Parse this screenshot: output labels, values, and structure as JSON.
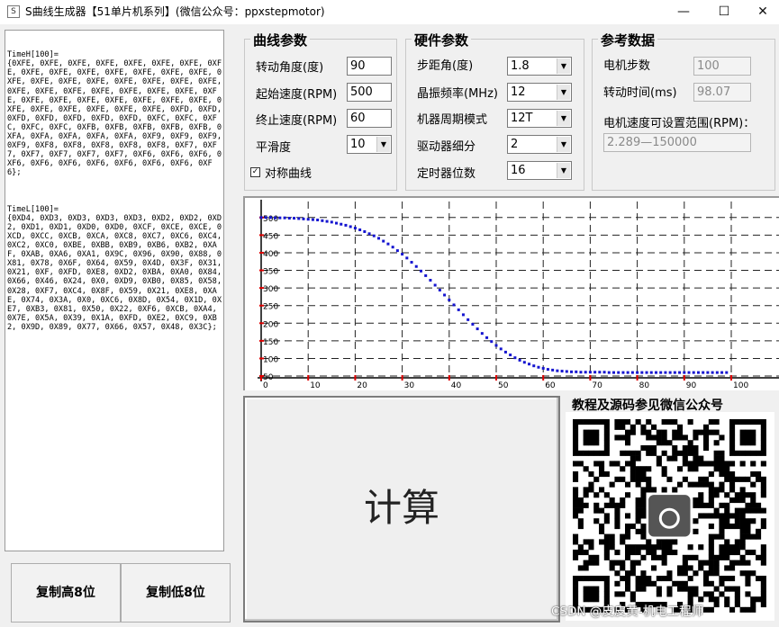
{
  "window": {
    "title": "S曲线生成器【51单片机系列】(微信公众号：ppхstepmotor)",
    "minimize": "—",
    "maximize": "☐",
    "close": "✕",
    "icon_label": "S"
  },
  "output": {
    "high_block": "TimeH[100]=\n{0XFE, 0XFE, 0XFE, 0XFE, 0XFE, 0XFE, 0XFE, 0XFE, 0XFE, 0XFE, 0XFE, 0XFE, 0XFE, 0XFE, 0XFE, 0XFE, 0XFE, 0XFE, 0XFE, 0XFE, 0XFE, 0XFE, 0XFE, 0XFE, 0XFE, 0XFE, 0XFE, 0XFE, 0XFE, 0XFE, 0XFE, 0XFE, 0XFE, 0XFE, 0XFE, 0XFE, 0XFE, 0XFE, 0XFE, 0XFE, 0XFE, 0XFE, 0XFE, 0XFE, 0XFD, 0XFD, 0XFD, 0XFD, 0XFD, 0XFD, 0XFD, 0XFC, 0XFC, 0XFC, 0XFC, 0XFC, 0XFB, 0XFB, 0XFB, 0XFB, 0XFB, 0XFA, 0XFA, 0XFA, 0XFA, 0XFA, 0XF9, 0XF9, 0XF9, 0XF9, 0XF8, 0XF8, 0XF8, 0XF8, 0XF8, 0XF7, 0XF7, 0XF7, 0XF7, 0XF7, 0XF7, 0XF6, 0XF6, 0XF6, 0XF6, 0XF6, 0XF6, 0XF6, 0XF6, 0XF6, 0XF6, 0XF6};",
    "low_block": "TimeL[100]=\n{0XD4, 0XD3, 0XD3, 0XD3, 0XD3, 0XD2, 0XD2, 0XD2, 0XD1, 0XD1, 0XD0, 0XD0, 0XCF, 0XCE, 0XCE, 0XCD, 0XCC, 0XCB, 0XCA, 0XC8, 0XC7, 0XC6, 0XC4, 0XC2, 0XC0, 0XBE, 0XBB, 0XB9, 0XB6, 0XB2, 0XAF, 0XAB, 0XA6, 0XA1, 0X9C, 0X96, 0X90, 0X88, 0X81, 0X78, 0X6F, 0X64, 0X59, 0X4D, 0X3F, 0X31, 0X21, 0XF, 0XFD, 0XE8, 0XD2, 0XBA, 0XA0, 0X84, 0X66, 0X46, 0X24, 0X0, 0XD9, 0XB0, 0X85, 0X58, 0X28, 0XF7, 0XC4, 0X8F, 0X59, 0X21, 0XE8, 0XAE, 0X74, 0X3A, 0X0, 0XC6, 0X8D, 0X54, 0X1D, 0XE7, 0XB3, 0X81, 0X50, 0X22, 0XF6, 0XCB, 0XA4, 0X7E, 0X5A, 0X39, 0X1A, 0XFD, 0XE2, 0XC9, 0XB2, 0X9D, 0X89, 0X77, 0X66, 0X57, 0X48, 0X3C};"
  },
  "buttons": {
    "copy_high": "复制高8位",
    "copy_low": "复制低8位",
    "calculate": "计算"
  },
  "curve_params": {
    "title": "曲线参数",
    "angle_label": "转动角度(度)",
    "angle_value": "90",
    "start_speed_label": "起始速度(RPM)",
    "start_speed_value": "500",
    "end_speed_label": "终止速度(RPM)",
    "end_speed_value": "60",
    "smooth_label": "平滑度",
    "smooth_value": "10",
    "symmetric_label": "对称曲线",
    "symmetric_checked": "✓"
  },
  "hardware_params": {
    "title": "硬件参数",
    "step_angle_label": "步距角(度)",
    "step_angle_value": "1.8",
    "crystal_label": "晶振频率(MHz)",
    "crystal_value": "12",
    "cycle_mode_label": "机器周期模式",
    "cycle_mode_value": "12T",
    "microstep_label": "驱动器细分",
    "microstep_value": "2",
    "timer_bits_label": "定时器位数",
    "timer_bits_value": "16"
  },
  "reference": {
    "title": "参考数据",
    "steps_label": "电机步数",
    "steps_value": "100",
    "time_label": "转动时间(ms)",
    "time_value": "98.07",
    "range_label": "电机速度可设置范围(RPM)：",
    "range_value": "2.289—150000"
  },
  "qr": {
    "caption": "教程及源码参见微信公众号"
  },
  "watermark": "CSDN @皮皮黄-机电工程师",
  "chart_data": {
    "type": "scatter",
    "x_ticks": [
      "0",
      "10",
      "20",
      "30",
      "40",
      "50",
      "60",
      "70",
      "80",
      "90",
      "100"
    ],
    "y_ticks": [
      "500",
      "450",
      "400",
      "350",
      "300",
      "250",
      "200",
      "150",
      "100",
      "50"
    ],
    "xlim": [
      0,
      100
    ],
    "ylim": [
      45,
      525
    ],
    "grid": true,
    "series_color": "#1515d0",
    "x": [
      0,
      1,
      2,
      3,
      4,
      5,
      6,
      7,
      8,
      9,
      10,
      11,
      12,
      13,
      14,
      15,
      16,
      17,
      18,
      19,
      20,
      21,
      22,
      23,
      24,
      25,
      26,
      27,
      28,
      29,
      30,
      31,
      32,
      33,
      34,
      35,
      36,
      37,
      38,
      39,
      40,
      41,
      42,
      43,
      44,
      45,
      46,
      47,
      48,
      49,
      50,
      51,
      52,
      53,
      54,
      55,
      56,
      57,
      58,
      59,
      60,
      61,
      62,
      63,
      64,
      65,
      66,
      67,
      68,
      69,
      70,
      71,
      72,
      73,
      74,
      75,
      76,
      77,
      78,
      79,
      80,
      81,
      82,
      83,
      84,
      85,
      86,
      87,
      88,
      89,
      90,
      91,
      92,
      93,
      94,
      95,
      96,
      97,
      98,
      99
    ],
    "y": [
      500,
      500,
      500,
      499,
      499,
      499,
      498,
      498,
      497,
      496,
      495,
      494,
      493,
      491,
      489,
      487,
      484,
      481,
      478,
      474,
      470,
      465,
      460,
      454,
      448,
      441,
      433,
      425,
      416,
      406,
      396,
      385,
      373,
      361,
      348,
      335,
      322,
      308,
      294,
      280,
      266,
      252,
      238,
      224,
      210,
      197,
      184,
      171,
      159,
      148,
      137,
      127,
      118,
      110,
      102,
      95,
      89,
      84,
      79,
      75,
      72,
      69,
      67,
      65,
      64,
      63,
      62,
      62,
      61,
      61,
      61,
      61,
      61,
      61,
      60,
      60,
      60,
      60,
      60,
      60,
      60,
      60,
      60,
      60,
      60,
      60,
      60,
      60,
      60,
      60,
      60,
      60,
      60,
      60,
      60,
      60,
      60,
      60,
      60,
      60
    ]
  }
}
